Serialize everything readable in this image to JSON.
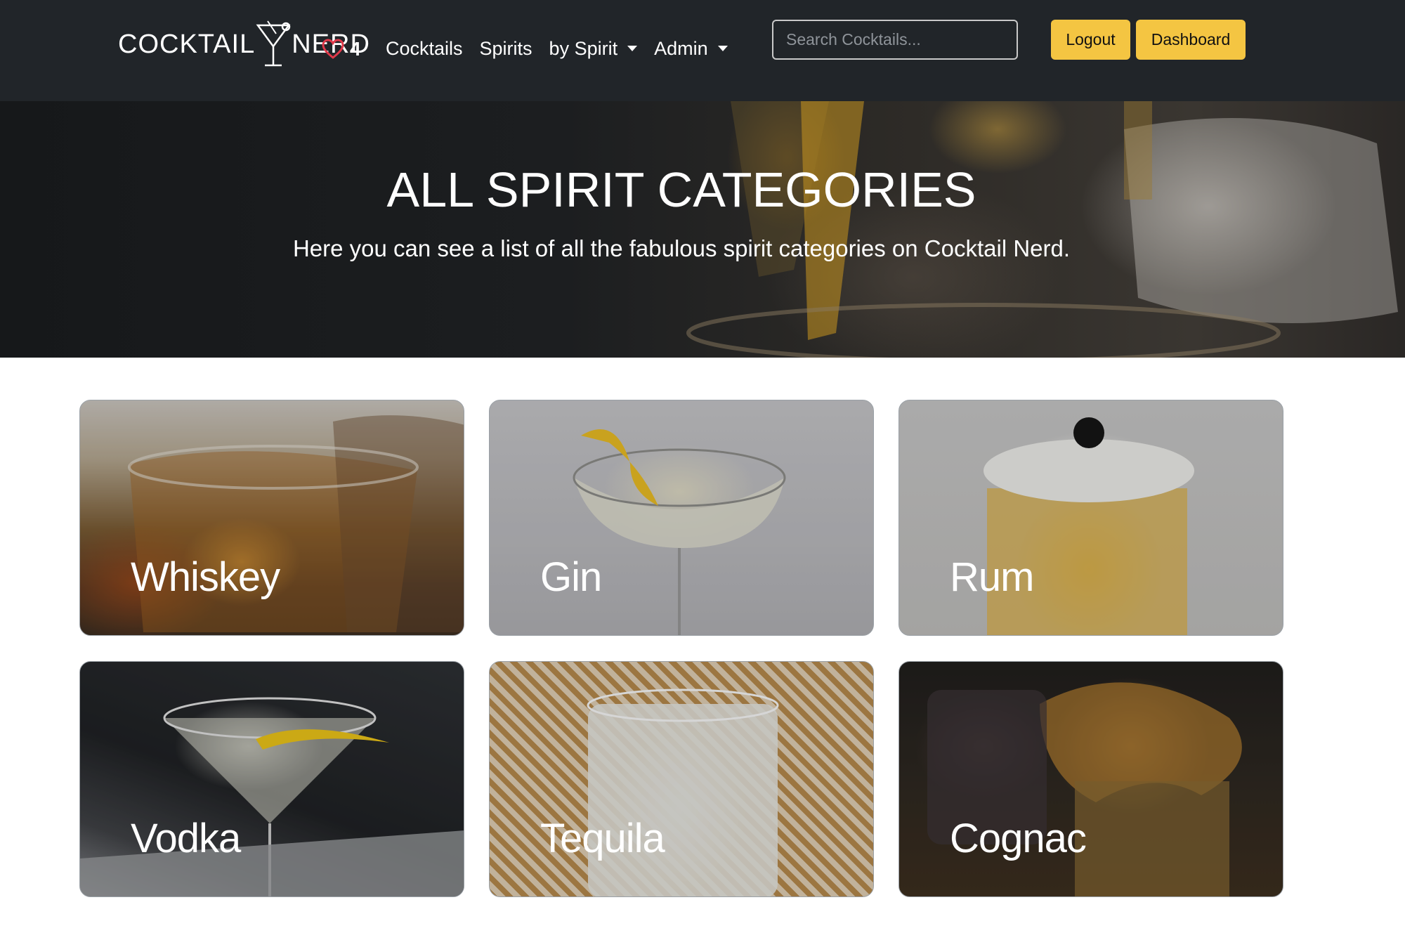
{
  "navbar": {
    "brand_left": "COCKTAIL",
    "brand_right": "NERD",
    "favorites_count": "4",
    "links": [
      {
        "label": "Cocktails",
        "dropdown": false
      },
      {
        "label": "Spirits",
        "dropdown": false
      },
      {
        "label": "by Spirit",
        "dropdown": true
      },
      {
        "label": "Admin",
        "dropdown": true
      }
    ],
    "search_placeholder": "Search Cocktails...",
    "logout_label": "Logout",
    "dashboard_label": "Dashboard",
    "background_color": "#212529",
    "button_color": "#f4c542",
    "heart_color": "#e0394a"
  },
  "hero": {
    "title": "ALL SPIRIT CATEGORIES",
    "subtitle": "Here you can see a list of all the fabulous spirit categories on Cocktail Nerd."
  },
  "categories": [
    {
      "label": "Whiskey"
    },
    {
      "label": "Gin"
    },
    {
      "label": "Rum"
    },
    {
      "label": "Vodka"
    },
    {
      "label": "Tequila"
    },
    {
      "label": "Cognac"
    }
  ]
}
